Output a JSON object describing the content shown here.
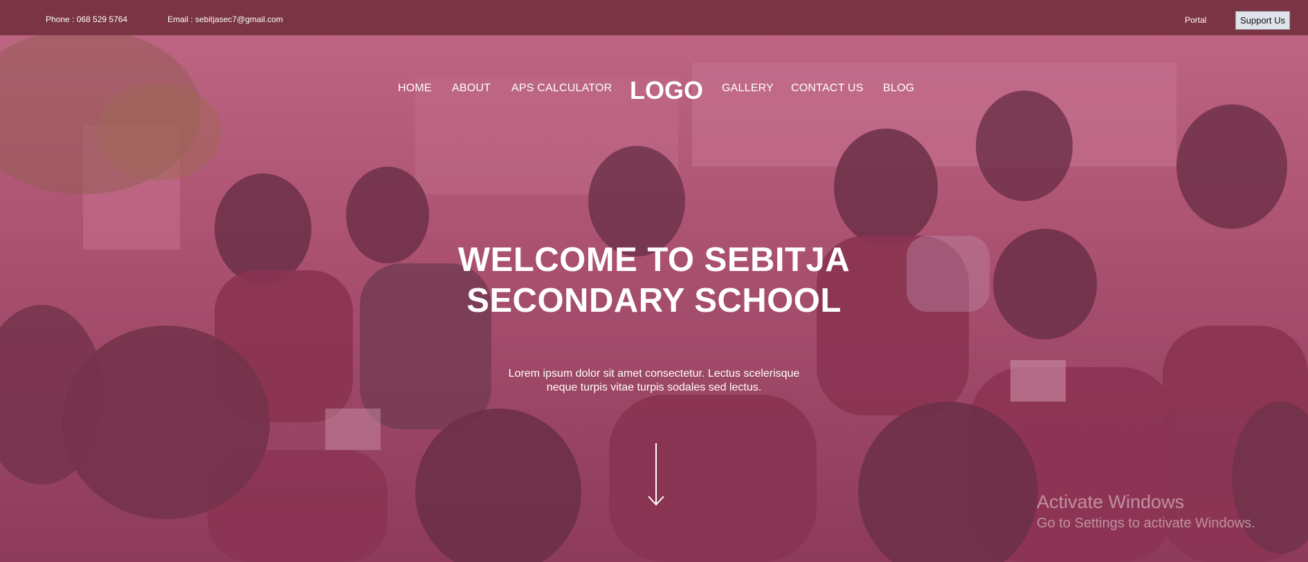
{
  "topbar": {
    "phone": "Phone : 068 529 5764",
    "email": "Email : sebitjasec7@gmail.com",
    "portal": "Portal",
    "support": "Support Us"
  },
  "nav": {
    "items": [
      {
        "label": "HOME"
      },
      {
        "label": "ABOUT"
      },
      {
        "label": "APS CALCULATOR"
      },
      {
        "label": "GALLERY"
      },
      {
        "label": "CONTACT US"
      },
      {
        "label": "BLOG"
      }
    ],
    "logo": "LOGO"
  },
  "hero": {
    "title_line1": "WELCOME TO SEBITJA",
    "title_line2": "SECONDARY SCHOOL",
    "subtitle_line1": "Lorem ipsum dolor sit amet consectetur. Lectus scelerisque",
    "subtitle_line2": "neque turpis vitae turpis sodales sed lectus.",
    "scroll_icon": "arrow-down-icon"
  },
  "watermark": {
    "line1": "Activate Windows",
    "line2": "Go to Settings to activate Windows."
  },
  "colors": {
    "topbar": "#7a3443",
    "hero_tint": "#a5566f",
    "text": "#ffffff",
    "support_button": "#dfe4ea"
  }
}
